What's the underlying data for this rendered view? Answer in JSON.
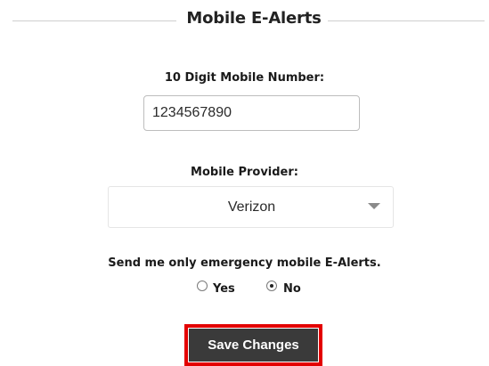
{
  "section": {
    "title": "Mobile E-Alerts"
  },
  "mobile_number": {
    "label": "10 Digit Mobile Number:",
    "value": "1234567890"
  },
  "provider": {
    "label": "Mobile Provider:",
    "selected": "Verizon"
  },
  "emergency": {
    "question": "Send me only emergency mobile E-Alerts.",
    "options": [
      {
        "label": "Yes",
        "checked": false
      },
      {
        "label": "No",
        "checked": true
      }
    ]
  },
  "actions": {
    "save_label": "Save Changes",
    "highlight_color": "#e30000",
    "button_color": "#3a3a3a"
  }
}
